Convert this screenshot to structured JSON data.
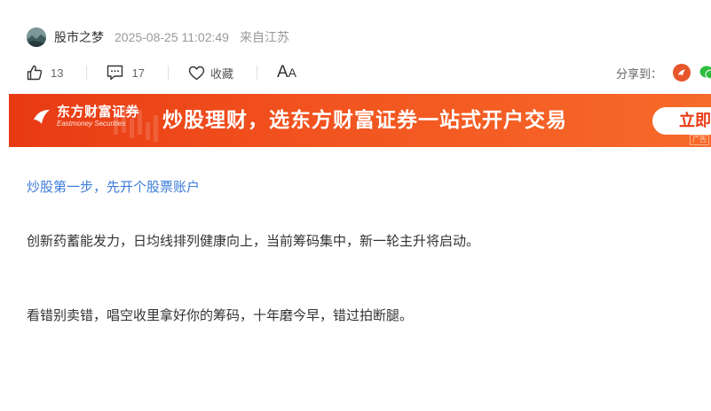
{
  "author": {
    "name": "股市之梦",
    "time": "2025-08-25 11:02:49",
    "location": "来自江苏"
  },
  "actions": {
    "like_count": "13",
    "comment_count": "17",
    "favorite_label": "收藏",
    "font_toggle_big": "A",
    "font_toggle_small": "A"
  },
  "share": {
    "label": "分享到："
  },
  "banner": {
    "logo_cn": "东方财富证券",
    "logo_en": "Eastmoney Securities",
    "slogan": "炒股理财，选东方财富证券一站式开户交易",
    "cta": "立即",
    "ad_tag": "广告",
    "colors": {
      "start": "#e83a14",
      "end": "#f66a2a"
    }
  },
  "content": {
    "promo_link": "炒股第一步，先开个股票账户",
    "paragraphs": [
      "创新药蓄能发力，日均线排列健康向上，当前筹码集中，新一轮主升将启动。",
      "看错别卖错，唱空收里拿好你的筹码，十年磨今早，错过拍断腿。"
    ]
  },
  "colors": {
    "link": "#3d7cd9",
    "text": "#333333",
    "muted": "#999999"
  }
}
